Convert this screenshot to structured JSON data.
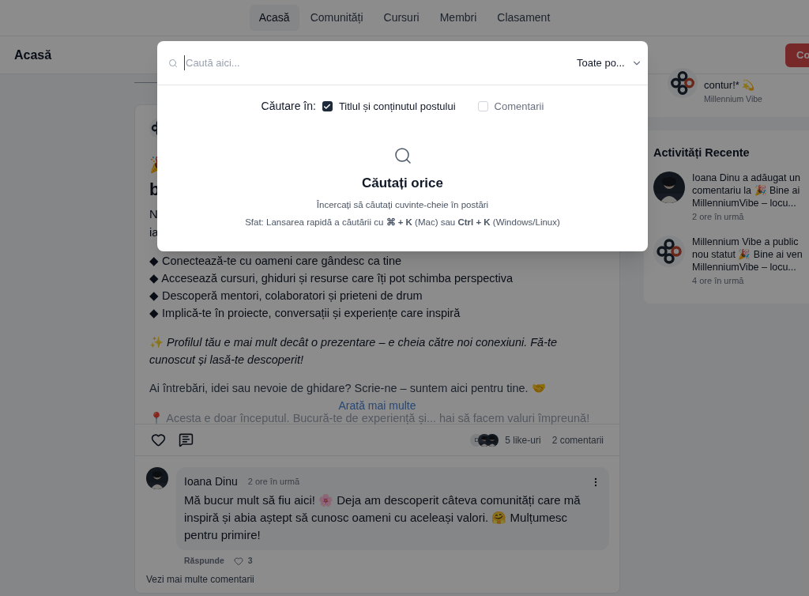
{
  "nav": {
    "tabs": [
      {
        "label": "Acasă",
        "selected": true
      },
      {
        "label": "Comunități",
        "selected": false
      },
      {
        "label": "Cursuri",
        "selected": false
      },
      {
        "label": "Membri",
        "selected": false
      },
      {
        "label": "Clasament",
        "selected": false
      }
    ]
  },
  "header": {
    "title": "Acasă",
    "button": "Co"
  },
  "post": {
    "emoji": "🎉",
    "title": "b",
    "intro_lines": [
      "N",
      "ia"
    ],
    "bullets": [
      "◆ Conectează-te cu oameni care gândesc ca tine",
      "◆ Accesează cursuri, ghiduri și resurse care îți pot schimba perspectiva",
      "◆ Descoperă mentori, colaboratori și prieteni de drum",
      "◆ Implică-te în proiecte, conversații și experiențe care inspiră"
    ],
    "highlight": "✨ *Profilul tău e mai mult decât o prezentare – e cheia către noi conexiuni. Fă-te cunoscut și lasă-te descoperit!*",
    "question": "Ai întrebări, idei sau nevoie de ghidare? Scrie-ne – suntem aici pentru tine. 🤝",
    "faded_line": "📍 Acesta e doar începutul. Bucură-te de experiență și... hai să facem valuri împreună!",
    "show_more": "Arată mai multe",
    "liker_initial": "D",
    "likes": "5 like-uri",
    "comments_count": "2 comentarii"
  },
  "comment": {
    "author": "Ioana Dinu",
    "time": "2 ore în urmă",
    "text": "Mă bucur mult să fiu aici! 🌸 Deja am descoperit câteva comunități care mă inspiră și abia aștept să cunosc oameni cu aceleași valori. 🤗 Mulțumesc pentru primire!",
    "reply": "Răspunde",
    "likes": "3"
  },
  "more_comments": "Vezi mai multe comentarii",
  "sidebar": {
    "top_item": {
      "text": "contur!* 💫",
      "author": "Millennium Vibe"
    },
    "recent": {
      "title": "Activități Recente",
      "items": [
        {
          "lines": [
            "Ioana Dinu a adăugat un",
            "comentariu la 🎉 Bine ai",
            "MillenniumVibe – locu..."
          ],
          "time": "2 ore în urmă"
        },
        {
          "kind": "logo",
          "lines": [
            "Millennium Vibe a public",
            "nou statut 🎉 Bine ai ven",
            "MillenniumVibe – locu..."
          ],
          "time": "4 ore în urmă"
        }
      ]
    }
  },
  "search": {
    "placeholder": "Caută aici...",
    "filter": "Toate po...",
    "scope_label": "Căutare în:",
    "scopes": [
      {
        "label": "Titlul și conținutul postului",
        "checked": true
      },
      {
        "label": "Comentarii",
        "checked": false
      }
    ],
    "empty_title": "Căutați orice",
    "empty_subtitle": "Încercați să căutați cuvinte-cheie în postări",
    "tip": "Sfat: Lansarea rapidă a căutării cu **⌘ + K** (Mac) sau **Ctrl + K** (Windows/Linux)"
  }
}
